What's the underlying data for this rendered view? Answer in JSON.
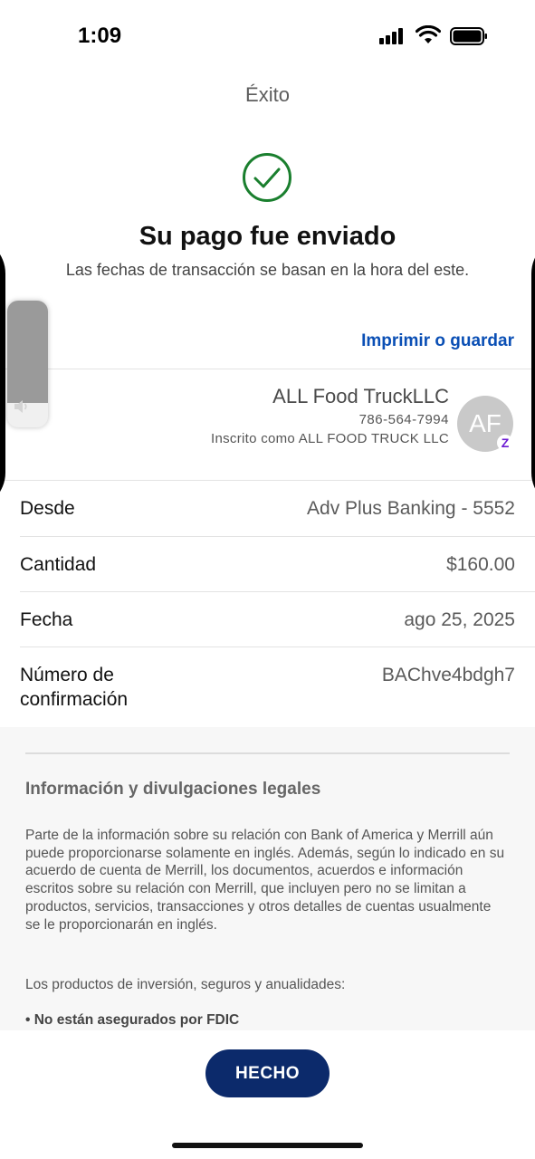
{
  "status_bar": {
    "time": "1:09",
    "icons": [
      "cellular-signal-icon",
      "wifi-icon",
      "battery-icon"
    ]
  },
  "nav": {
    "title": "Éxito"
  },
  "confirmation": {
    "icon": "check-circle-icon",
    "headline": "Su pago fue enviado",
    "subtitle": "Las fechas de transacción se basan en la hora del este."
  },
  "actions": {
    "print_label": "Imprimir o guardar",
    "done_label": "HECHO"
  },
  "payee": {
    "name": "ALL Food TruckLLC",
    "phone": "786-564-7994",
    "enrolled_as": "Inscrito como ALL FOOD TRUCK LLC",
    "avatar_initials": "AF",
    "badge_icon": "zelle-icon"
  },
  "details": [
    {
      "label": "Desde",
      "value": "Adv Plus Banking - 5552"
    },
    {
      "label": "Cantidad",
      "value": "$160.00"
    },
    {
      "label": "Fecha",
      "value": "ago 25, 2025"
    },
    {
      "label": "Número de confirmación",
      "value": "BAChve4bdgh7"
    }
  ],
  "legal": {
    "title": "Información y divulgaciones legales",
    "paragraph_1": "Parte de la información sobre su relación con Bank of America y Merrill aún puede proporcionarse solamente en inglés. Además, según lo indicado en su acuerdo de cuenta de Merrill, los documentos, acuerdos e información escritos sobre su relación con Merrill, que incluyen pero no se limitan a productos, servicios, transacciones y otros detalles de cuentas usualmente se le proporcionarán en inglés.",
    "paragraph_2": "Los productos de inversión, seguros y anualidades:",
    "bullet_1": "• No están asegurados por FDIC"
  },
  "volume_overlay": {
    "level": 0.81,
    "icon": "speaker-icon"
  },
  "colors": {
    "accent_link": "#0a4fb5",
    "button_bg": "#0c2a6b",
    "success_green": "#1a7f2e"
  }
}
